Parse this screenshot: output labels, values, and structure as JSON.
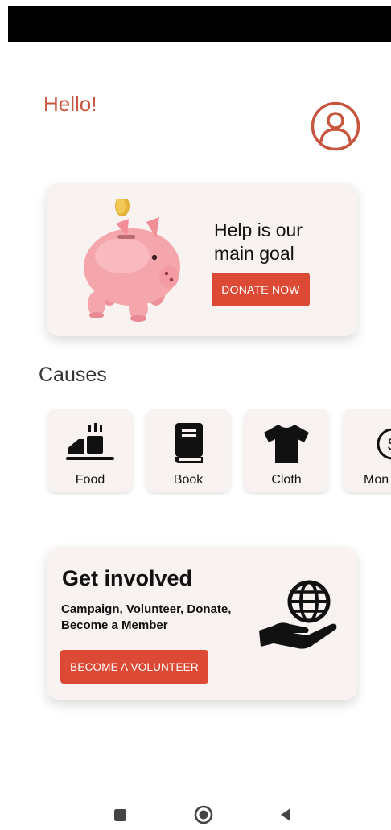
{
  "header": {
    "greeting": "Hello!",
    "profile_icon": "user-circle-icon"
  },
  "hero": {
    "title": "Help is our main goal",
    "button_label": "DONATE NOW",
    "image": "piggy-bank-icon"
  },
  "causes": {
    "title": "Causes",
    "items": [
      {
        "label": "Food",
        "icon": "food-icon"
      },
      {
        "label": "Book",
        "icon": "book-icon"
      },
      {
        "label": "Cloth",
        "icon": "tshirt-icon"
      },
      {
        "label": "Mon",
        "icon": "money-icon"
      }
    ]
  },
  "involve": {
    "title": "Get involved",
    "subtitle": "Campaign, Volunteer, Donate, Become a Member",
    "button_label": "BECOME A VOLUNTEER",
    "image": "globe-in-hand-icon"
  },
  "nav": {
    "items": [
      "recents-square-icon",
      "home-circle-icon",
      "back-triangle-icon"
    ]
  },
  "colors": {
    "accent": "#dc4a35",
    "greeting": "#c8553d",
    "card_bg": "#f8f2f1",
    "status_bar": "#000000"
  }
}
